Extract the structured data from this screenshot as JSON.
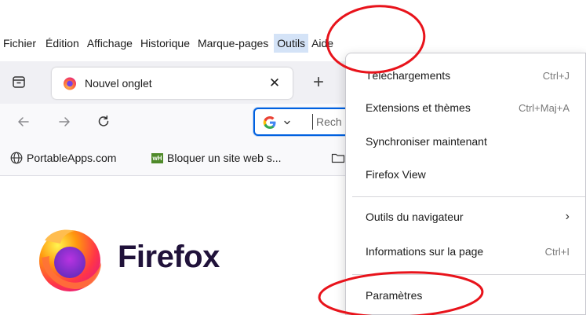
{
  "menubar": {
    "items": [
      {
        "label": "Fichier"
      },
      {
        "label": "Édition"
      },
      {
        "label": "Affichage"
      },
      {
        "label": "Historique"
      },
      {
        "label": "Marque-pages"
      },
      {
        "label": "Outils",
        "active": true
      },
      {
        "label": "Aide"
      }
    ]
  },
  "tabstrip": {
    "tab_title": "Nouvel onglet",
    "close_glyph": "✕",
    "new_tab_glyph": "+"
  },
  "navbar": {
    "search_placeholder": "Rech",
    "search_engine": "Google"
  },
  "bookmarks": {
    "items": [
      {
        "label": "PortableApps.com",
        "icon": "globe-icon"
      },
      {
        "label": "Bloquer un site web s...",
        "icon": "wh-icon",
        "badge": "wH"
      }
    ]
  },
  "content": {
    "wordmark": "Firefox"
  },
  "dropdown": {
    "items": [
      {
        "label": "Téléchargements",
        "shortcut": "Ctrl+J"
      },
      {
        "label": "Extensions et thèmes",
        "shortcut": "Ctrl+Maj+A"
      },
      {
        "label": "Synchroniser maintenant",
        "shortcut": ""
      },
      {
        "label": "Firefox View",
        "shortcut": ""
      },
      {
        "label": "Outils du navigateur",
        "submenu_glyph": "›"
      },
      {
        "label": "Informations sur la page",
        "shortcut": "Ctrl+I"
      },
      {
        "label": "Paramètres",
        "shortcut": ""
      }
    ]
  },
  "annotation_color": "#e8131b"
}
